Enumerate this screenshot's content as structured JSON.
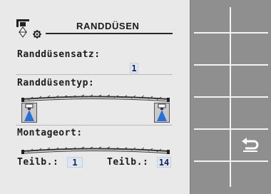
{
  "header": {
    "title": "RANDDÜSEN",
    "icon": "boom-nozzle-gear-icon"
  },
  "section1": {
    "label": "Randdüsensatz:",
    "value": "1"
  },
  "section2": {
    "label": "Randdüsentyp:",
    "boom_icon": "boom-icon",
    "left_nozzle_icon": "left-nozzle-icon",
    "right_nozzle_icon": "right-nozzle-icon"
  },
  "section3": {
    "label": "Montageort:",
    "boom_icon": "boom-icon",
    "left_label": "Teilb.:",
    "left_value": "1",
    "right_label": "Teilb.:",
    "right_value": "14"
  },
  "softkeys": {
    "return_icon": "return-arrow-icon"
  },
  "colors": {
    "panel_bg": "#e9e9e9",
    "softkey_bg": "#8f8f8f",
    "value_bg": "#dde7f2",
    "nozzle_blue": "#2a6fd6"
  }
}
